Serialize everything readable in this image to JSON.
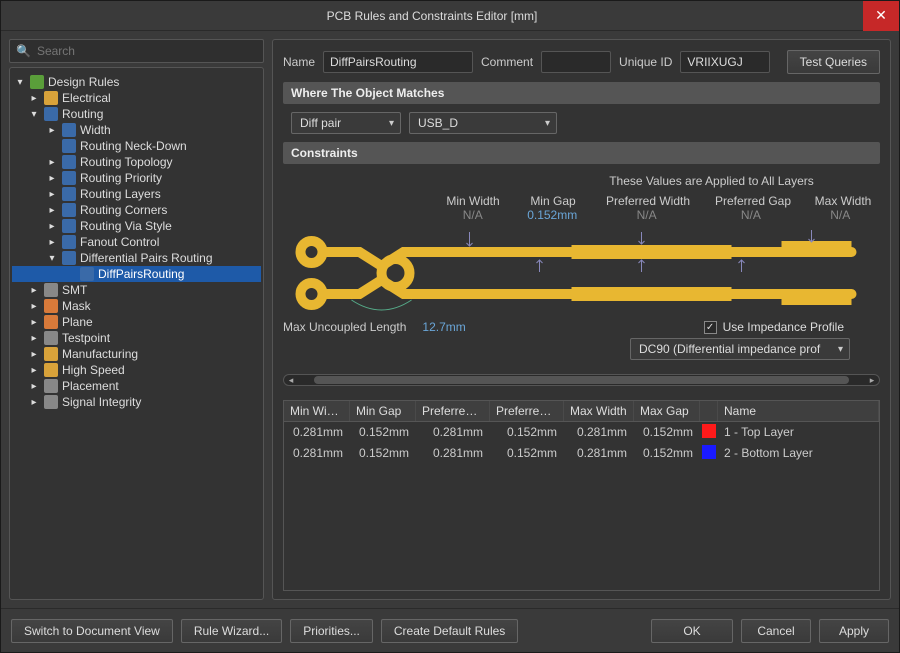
{
  "window": {
    "title": "PCB Rules and Constraints Editor [mm]"
  },
  "search": {
    "placeholder": "Search"
  },
  "tree": {
    "root": "Design Rules",
    "electrical": "Electrical",
    "routing": "Routing",
    "width": "Width",
    "neckdown": "Routing Neck-Down",
    "topology": "Routing Topology",
    "priority": "Routing Priority",
    "layers": "Routing Layers",
    "corners": "Routing Corners",
    "viastyle": "Routing Via Style",
    "fanout": "Fanout Control",
    "diffpairs": "Differential Pairs Routing",
    "diffpairs_rule": "DiffPairsRouting",
    "smt": "SMT",
    "mask": "Mask",
    "plane": "Plane",
    "testpoint": "Testpoint",
    "manufacturing": "Manufacturing",
    "highspeed": "High Speed",
    "placement": "Placement",
    "signal": "Signal Integrity"
  },
  "rule": {
    "name_label": "Name",
    "name_value": "DiffPairsRouting",
    "comment_label": "Comment",
    "comment_value": "",
    "uid_label": "Unique ID",
    "uid_value": "VRIIXUGJ",
    "test_queries": "Test Queries"
  },
  "match": {
    "header": "Where The Object Matches",
    "scope": "Diff pair",
    "value": "USB_D"
  },
  "constraints": {
    "header": "Constraints",
    "applied": "These Values are Applied to All Layers",
    "cols": {
      "minw": "Min Width",
      "ming": "Min Gap",
      "prefw": "Preferred Width",
      "prefg": "Preferred Gap",
      "maxw": "Max Width"
    },
    "vals": {
      "minw": "N/A",
      "ming": "0.152mm",
      "prefw": "N/A",
      "prefg": "N/A",
      "maxw": "N/A"
    },
    "max_uncoupled_label": "Max Uncoupled Length",
    "max_uncoupled_value": "12.7mm",
    "use_impedance": "Use Impedance Profile",
    "impedance_profile": "DC90 (Differential impedance prof"
  },
  "grid": {
    "headers": {
      "minw": "Min Width",
      "ming": "Min Gap",
      "prefw": "Preferred ...",
      "prefg": "Preferred ...",
      "maxw": "Max Width",
      "maxg": "Max Gap",
      "name": "Name"
    },
    "rows": [
      {
        "minw": "0.281mm",
        "ming": "0.152mm",
        "prefw": "0.281mm",
        "prefg": "0.152mm",
        "maxw": "0.281mm",
        "maxg": "0.152mm",
        "color": "#ff1a1a",
        "name": "1 - Top Layer"
      },
      {
        "minw": "0.281mm",
        "ming": "0.152mm",
        "prefw": "0.281mm",
        "prefg": "0.152mm",
        "maxw": "0.281mm",
        "maxg": "0.152mm",
        "color": "#1a1aff",
        "name": "2 - Bottom Layer"
      }
    ]
  },
  "footer": {
    "switch": "Switch to Document View",
    "wizard": "Rule Wizard...",
    "priorities": "Priorities...",
    "defaults": "Create Default Rules",
    "ok": "OK",
    "cancel": "Cancel",
    "apply": "Apply"
  }
}
